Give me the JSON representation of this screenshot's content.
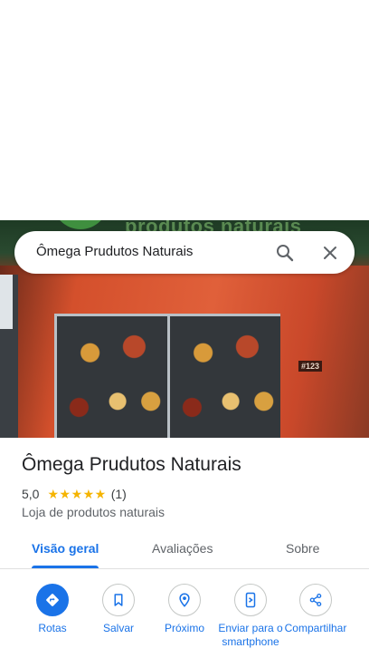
{
  "search": {
    "query": "Ômega Prudutos Naturais"
  },
  "hero": {
    "sign_text": "produtos naturais",
    "plate_number": "#123"
  },
  "place": {
    "title": "Ômega Prudutos Naturais",
    "rating_value": "5,0",
    "stars": "★★★★★",
    "rating_count": "(1)",
    "category": "Loja de produtos naturais"
  },
  "tabs": [
    {
      "label": "Visão geral",
      "active": true
    },
    {
      "label": "Avaliações",
      "active": false
    },
    {
      "label": "Sobre",
      "active": false
    }
  ],
  "actions": [
    {
      "label": "Rotas",
      "icon": "directions-icon"
    },
    {
      "label": "Salvar",
      "icon": "bookmark-icon"
    },
    {
      "label": "Próximo",
      "icon": "nearby-icon"
    },
    {
      "label": "Enviar para o smartphone",
      "icon": "send-to-phone-icon"
    },
    {
      "label": "Compartilhar",
      "icon": "share-icon"
    }
  ],
  "colors": {
    "accent": "#1a73e8",
    "star": "#f5b400"
  }
}
